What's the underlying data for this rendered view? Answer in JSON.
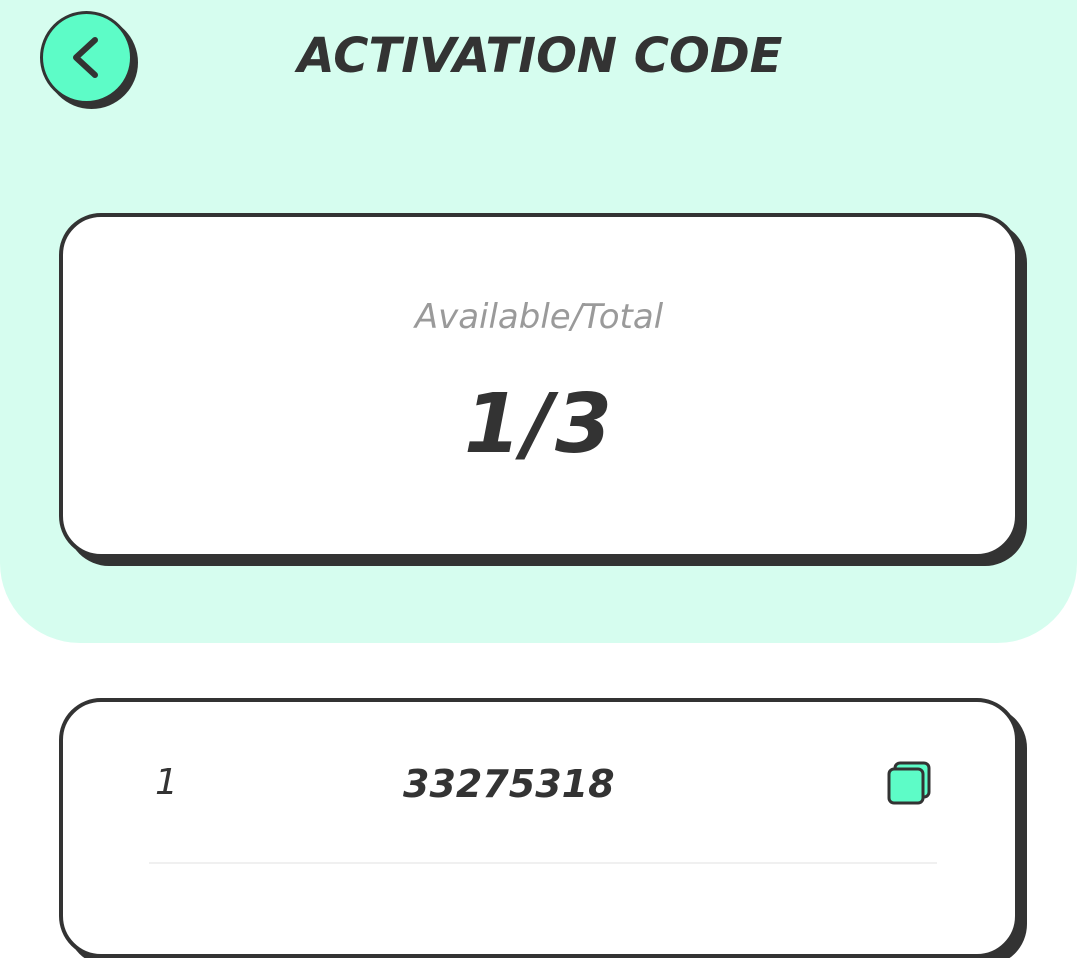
{
  "header": {
    "title": "ACTIVATION CODE",
    "back_icon": "chevron-left-icon"
  },
  "summary": {
    "label": "Available/Total",
    "available": 1,
    "total": 3,
    "display": "1/3"
  },
  "codes": [
    {
      "index": "1",
      "code": "33275318",
      "copy_icon": "copy-icon"
    }
  ],
  "colors": {
    "background_tint": "#d6fdef",
    "accent": "#5dfcc7",
    "ink": "#333333",
    "muted_text": "#9a9a9a",
    "card": "#ffffff"
  }
}
